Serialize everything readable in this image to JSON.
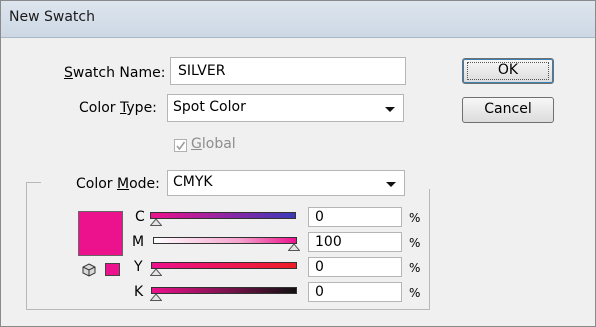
{
  "dialog": {
    "title": "New Swatch",
    "swatch_name_label": "Swatch Name:",
    "swatch_name_value": "SILVER",
    "color_type_label": "Color Type:",
    "color_type_value": "Spot Color",
    "global_label": "Global",
    "global_checked": true,
    "global_enabled": false,
    "color_mode_label": "Color Mode:",
    "color_mode_value": "CMYK",
    "ok_label": "OK",
    "cancel_label": "Cancel"
  },
  "color": {
    "swatch_hex": "#ec128d",
    "channels": [
      {
        "name": "C",
        "value": "0",
        "unit": "%"
      },
      {
        "name": "M",
        "value": "100",
        "unit": "%"
      },
      {
        "name": "Y",
        "value": "0",
        "unit": "%"
      },
      {
        "name": "K",
        "value": "0",
        "unit": "%"
      }
    ]
  },
  "icons": [
    "checkbox-check-icon",
    "dropdown-arrow-icon",
    "cube-icon",
    "slider-thumb-icon"
  ]
}
